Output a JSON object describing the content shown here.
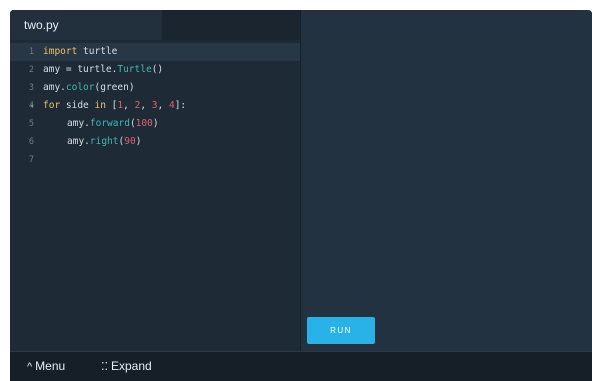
{
  "editor": {
    "tab_label": "two.py",
    "lines": [
      {
        "number": "1",
        "tokens": [
          {
            "t": "import",
            "c": "kw"
          },
          {
            "t": " turtle",
            "c": "plain"
          }
        ]
      },
      {
        "number": "2",
        "tokens": [
          {
            "t": "amy = turtle.",
            "c": "plain"
          },
          {
            "t": "Turtle",
            "c": "fn"
          },
          {
            "t": "()",
            "c": "plain"
          }
        ]
      },
      {
        "number": "3",
        "tokens": [
          {
            "t": "amy.",
            "c": "plain"
          },
          {
            "t": "color",
            "c": "fn"
          },
          {
            "t": "(green)",
            "c": "plain"
          }
        ]
      },
      {
        "number": "4",
        "tokens": [
          {
            "t": "for",
            "c": "kw"
          },
          {
            "t": " side ",
            "c": "plain"
          },
          {
            "t": "in",
            "c": "kw"
          },
          {
            "t": " [",
            "c": "plain"
          },
          {
            "t": "1",
            "c": "num"
          },
          {
            "t": ", ",
            "c": "plain"
          },
          {
            "t": "2",
            "c": "num"
          },
          {
            "t": ", ",
            "c": "plain"
          },
          {
            "t": "3",
            "c": "num"
          },
          {
            "t": ", ",
            "c": "plain"
          },
          {
            "t": "4",
            "c": "num"
          },
          {
            "t": "]:",
            "c": "plain"
          }
        ],
        "fold": true
      },
      {
        "number": "5",
        "tokens": [
          {
            "t": "amy.",
            "c": "plain"
          },
          {
            "t": "forward",
            "c": "fn"
          },
          {
            "t": "(",
            "c": "plain"
          },
          {
            "t": "100",
            "c": "num"
          },
          {
            "t": ")",
            "c": "plain"
          }
        ],
        "indent": 1
      },
      {
        "number": "6",
        "tokens": [
          {
            "t": "amy.",
            "c": "plain"
          },
          {
            "t": "right",
            "c": "fn"
          },
          {
            "t": "(",
            "c": "plain"
          },
          {
            "t": "90",
            "c": "num"
          },
          {
            "t": ")",
            "c": "plain"
          }
        ],
        "indent": 1
      },
      {
        "number": "7",
        "tokens": []
      }
    ]
  },
  "output": {
    "run_label": "RUN"
  },
  "bottom_bar": {
    "menu_icon": "chevron-up-icon",
    "menu_label": "Menu",
    "expand_icon": "expand-icon",
    "expand_label": "Expand"
  },
  "colors": {
    "editor_bg": "#1e2b37",
    "output_bg": "#223240",
    "run_button": "#29b2e8",
    "keyword": "#e9c36a",
    "function": "#3fb8b4",
    "number": "#e25f6c"
  }
}
